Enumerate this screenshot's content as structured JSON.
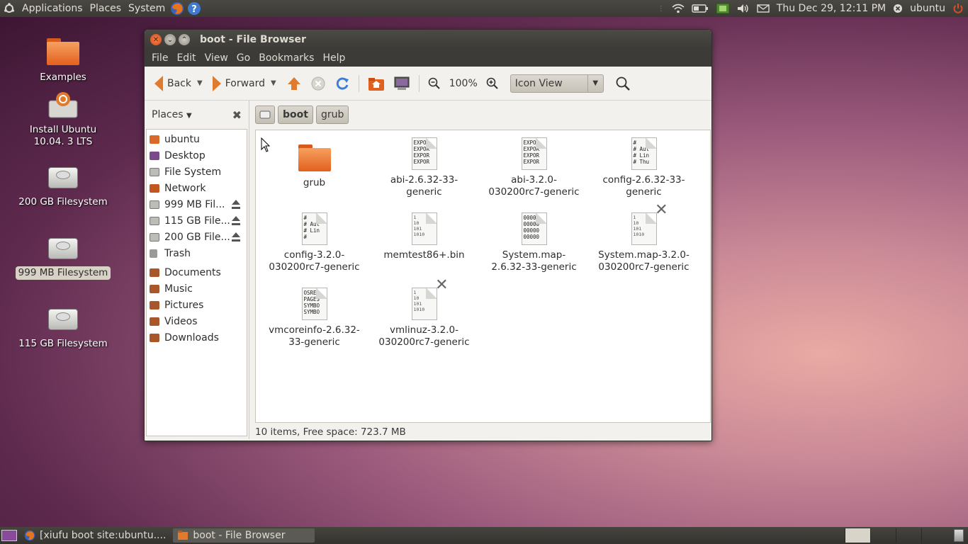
{
  "top_panel": {
    "menus": [
      "Applications",
      "Places",
      "System"
    ],
    "clock": "Thu Dec 29, 12:11 PM",
    "user": "ubuntu"
  },
  "desktop": {
    "icons": [
      {
        "label": "Examples",
        "kind": "folder"
      },
      {
        "label": "Install Ubuntu 10.04. 3 LTS",
        "kind": "installer"
      },
      {
        "label": "200 GB Filesystem",
        "kind": "drive"
      },
      {
        "label": "999 MB Filesystem",
        "kind": "drive",
        "selected": true
      },
      {
        "label": "115 GB Filesystem",
        "kind": "drive"
      }
    ]
  },
  "window": {
    "title": "boot - File Browser",
    "menu": [
      "File",
      "Edit",
      "View",
      "Go",
      "Bookmarks",
      "Help"
    ],
    "toolbar": {
      "back": "Back",
      "forward": "Forward",
      "zoom": "100%",
      "view_mode": "Icon View"
    },
    "sidebar": {
      "header": "Places",
      "items": [
        {
          "label": "ubuntu",
          "icon": "home-icon"
        },
        {
          "label": "Desktop",
          "icon": "desktop-icon"
        },
        {
          "label": "File System",
          "icon": "drive-icon"
        },
        {
          "label": "Network",
          "icon": "network-icon"
        },
        {
          "label": "999 MB Fil...",
          "icon": "drive-icon",
          "eject": true
        },
        {
          "label": "115 GB File...",
          "icon": "drive-icon",
          "eject": true
        },
        {
          "label": "200 GB File...",
          "icon": "drive-icon",
          "eject": true
        },
        {
          "label": "Trash",
          "icon": "trash-icon"
        }
      ],
      "bookmarks": [
        {
          "label": "Documents",
          "icon": "folder-icon"
        },
        {
          "label": "Music",
          "icon": "music-icon"
        },
        {
          "label": "Pictures",
          "icon": "pictures-icon"
        },
        {
          "label": "Videos",
          "icon": "videos-icon"
        },
        {
          "label": "Downloads",
          "icon": "folder-icon"
        }
      ]
    },
    "pathbar": [
      "boot",
      "grub"
    ],
    "files": [
      {
        "name": "grub",
        "kind": "folder"
      },
      {
        "name": "abi-2.6.32-33-generic",
        "kind": "text",
        "preview": "EXPOR\nEXPOR\nEXPOR\nEXPOR"
      },
      {
        "name": "abi-3.2.0-030200rc7-generic",
        "kind": "text",
        "preview": "EXPOR\nEXPOR\nEXPOR\nEXPOR"
      },
      {
        "name": "config-2.6.32-33-generic",
        "kind": "text",
        "preview": "#\n# Aut\n# Lin\n# Thu"
      },
      {
        "name": "config-3.2.0-030200rc7-generic",
        "kind": "text",
        "preview": "#\n# Aut\n# Lin\n#"
      },
      {
        "name": "memtest86+.bin",
        "kind": "binary",
        "preview": "1\n10\n101\n1010"
      },
      {
        "name": "System.map-2.6.32-33-generic",
        "kind": "text",
        "preview": "00000\n00000\n00000\n00000"
      },
      {
        "name": "System.map-3.2.0-030200rc7-generic",
        "kind": "binary",
        "preview": "1\n10\n101\n1010",
        "unreadable": true
      },
      {
        "name": "vmcoreinfo-2.6.32-33-generic",
        "kind": "text",
        "preview": "OSREL\nPAGES\nSYMBO\nSYMBO"
      },
      {
        "name": "vmlinuz-3.2.0-030200rc7-generic",
        "kind": "binary",
        "preview": "1\n10\n101\n1010",
        "unreadable": true
      }
    ],
    "status": "10 items, Free space: 723.7 MB"
  },
  "bottom_panel": {
    "tasks": [
      {
        "label": "[xiufu boot site:ubuntu....",
        "icon": "firefox-icon"
      },
      {
        "label": "boot - File Browser",
        "icon": "file-browser-icon",
        "active": true
      }
    ]
  },
  "colors": {
    "accent_orange": "#e07b2e",
    "panel": "#3c3b37"
  }
}
